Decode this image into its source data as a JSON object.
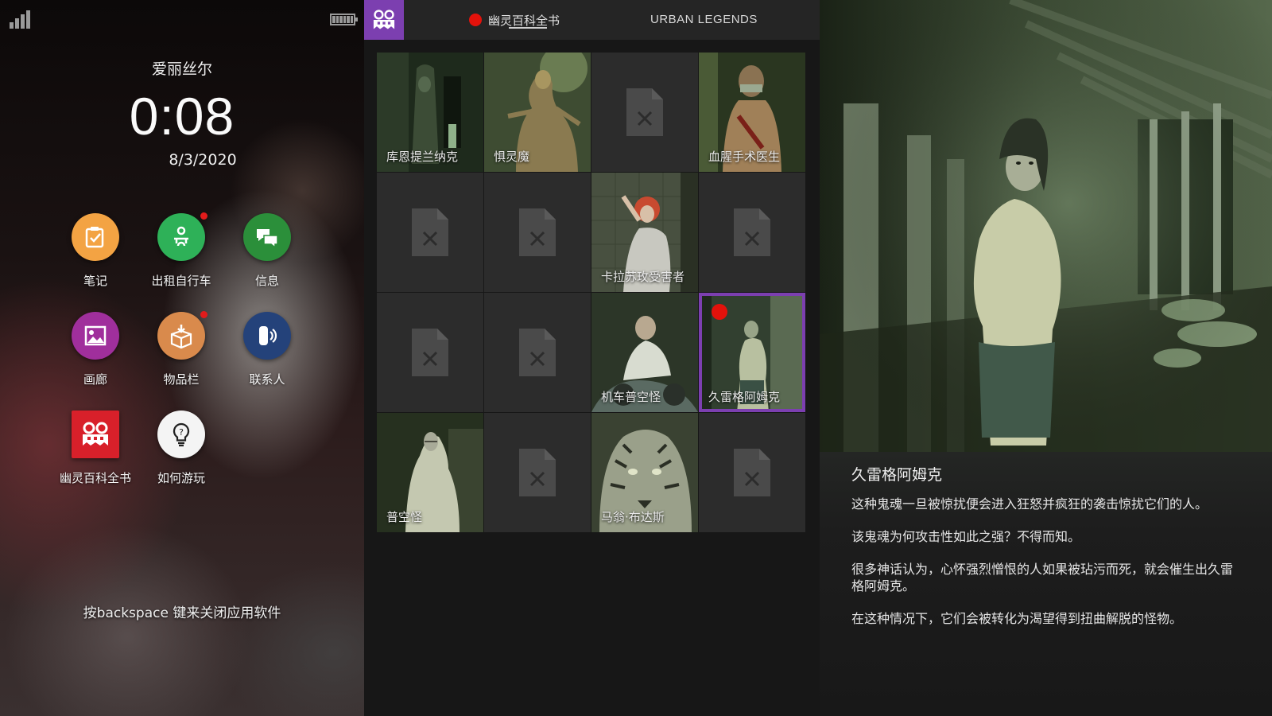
{
  "phone": {
    "owner": "爱丽丝尔",
    "time": "0:08",
    "date": "8/3/2020",
    "hint": "按backspace 键来关闭应用软件",
    "apps": [
      {
        "label": "笔记",
        "icon": "notes-checklist-icon",
        "color": "#f3a343",
        "badge": false
      },
      {
        "label": "出租自行车",
        "icon": "bike-rental-icon",
        "color": "#2eb158",
        "badge": true
      },
      {
        "label": "信息",
        "icon": "chat-bubbles-icon",
        "color": "#2b8f3a",
        "badge": false
      },
      {
        "label": "画廊",
        "icon": "gallery-picture-icon",
        "color": "#a02f9c",
        "badge": false
      },
      {
        "label": "物品栏",
        "icon": "inventory-box-icon",
        "color": "#d98a4c",
        "badge": true
      },
      {
        "label": "联系人",
        "icon": "phone-contact-icon",
        "color": "#24427a",
        "badge": false
      },
      {
        "label": "幽灵百科全书",
        "icon": "ghost-encyclopedia-icon",
        "color": "#d8202a",
        "badge": false
      },
      {
        "label": "如何游玩",
        "icon": "lightbulb-help-icon",
        "color": "#f4f4f4",
        "badge": false
      }
    ]
  },
  "center": {
    "tab_active": "幽灵百科全书",
    "tab_other": "URBAN LEGENDS",
    "ghosts": [
      {
        "name": "库恩提兰纳克",
        "locked": false,
        "art": "corridor-ghost"
      },
      {
        "name": "惧灵魔",
        "locked": false,
        "art": "creature"
      },
      {
        "name": "",
        "locked": true
      },
      {
        "name": "血腥手术医生",
        "locked": false,
        "art": "surgeon"
      },
      {
        "name": "",
        "locked": true
      },
      {
        "name": "",
        "locked": true
      },
      {
        "name": "卡拉苏玫受害者",
        "locked": false,
        "art": "redhair"
      },
      {
        "name": "",
        "locked": true
      },
      {
        "name": "",
        "locked": true
      },
      {
        "name": "",
        "locked": true
      },
      {
        "name": "机车普空怪",
        "locked": false,
        "art": "biker"
      },
      {
        "name": "久雷格阿姆克",
        "locked": false,
        "art": "girl",
        "selected": true
      },
      {
        "name": "普空怪",
        "locked": false,
        "art": "shroud"
      },
      {
        "name": "",
        "locked": true
      },
      {
        "name": "马翁·布达斯",
        "locked": false,
        "art": "tiger"
      },
      {
        "name": "",
        "locked": true
      }
    ]
  },
  "detail": {
    "title": "久雷格阿姆克",
    "paragraphs": [
      "这种鬼魂一旦被惊扰便会进入狂怒并疯狂的袭击惊扰它们的人。",
      "该鬼魂为何攻击性如此之强？不得而知。",
      "很多神话认为，心怀强烈憎恨的人如果被玷污而死，就会催生出久雷格阿姆克。",
      "在这种情况下，它们会被转化为渴望得到扭曲解脱的怪物。"
    ]
  },
  "colors": {
    "accent_purple": "#7c3fb0",
    "record_red": "#e3120b",
    "notification_red": "#e21b1b"
  }
}
